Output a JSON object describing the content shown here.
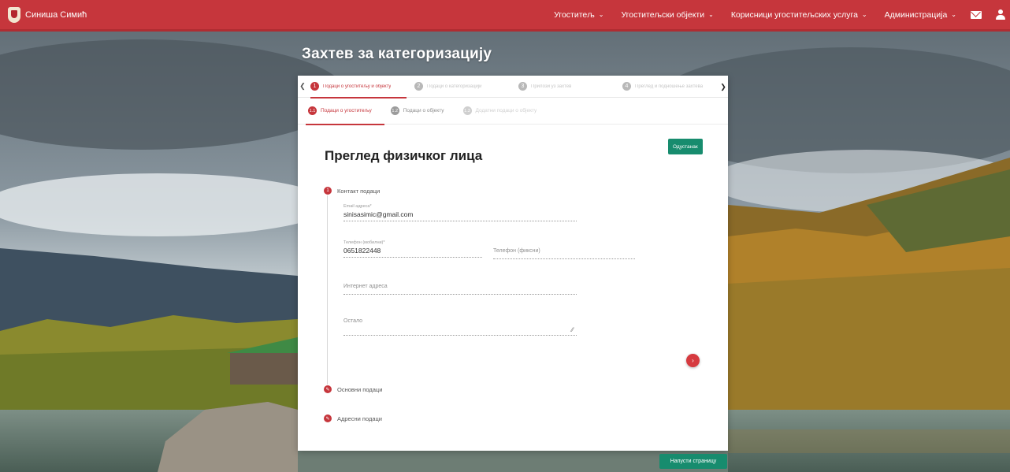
{
  "header": {
    "brand_name": "Синиша Симић",
    "nav": [
      {
        "label": "Угоститељ"
      },
      {
        "label": "Угоститељски објекти"
      },
      {
        "label": "Корисници угоститељских услуга"
      },
      {
        "label": "Администрација"
      }
    ],
    "icons": [
      "mail-icon",
      "user-icon"
    ]
  },
  "page": {
    "title": "Захтев за категоризацију"
  },
  "stepper": {
    "steps": [
      {
        "number": "1",
        "label": "Подаци о угоститељу и објекту",
        "active": true
      },
      {
        "number": "2",
        "label": "Подаци о категоризацији",
        "active": false
      },
      {
        "number": "3",
        "label": "Прилози уз захтев",
        "active": false
      },
      {
        "number": "4",
        "label": "Преглед и подношење захтева",
        "active": false
      }
    ],
    "substeps": [
      {
        "number": "1.1",
        "label": "Подаци о угоститељу",
        "state": "active"
      },
      {
        "number": "1.2",
        "label": "Подаци о објекту",
        "state": "normal"
      },
      {
        "number": "1.3",
        "label": "Додатни подаци о објекту",
        "state": "disabled"
      }
    ]
  },
  "form": {
    "cancel_label": "Одустанак",
    "heading": "Преглед физичког лица",
    "sections": [
      {
        "number": "1",
        "label": "Контакт подаци"
      },
      {
        "number": "2",
        "label": "Основни подаци"
      },
      {
        "number": "3",
        "label": "Адресни подаци"
      }
    ],
    "fields": {
      "email": {
        "label": "Email адреса*",
        "value": "sinisasimic@gmail.com"
      },
      "phone": {
        "label": "Телефон (мобилни)*",
        "value": "0651822448"
      },
      "phone_fixed": {
        "placeholder": "Телефон (фиксни)"
      },
      "web": {
        "placeholder": "Интернет адреса"
      },
      "note": {
        "placeholder": "Остало"
      }
    },
    "next_label": "›"
  },
  "footer": {
    "leave_label": "Напусти страницу"
  },
  "colors": {
    "brand_red": "#c6363c",
    "action_green": "#178c6e"
  }
}
